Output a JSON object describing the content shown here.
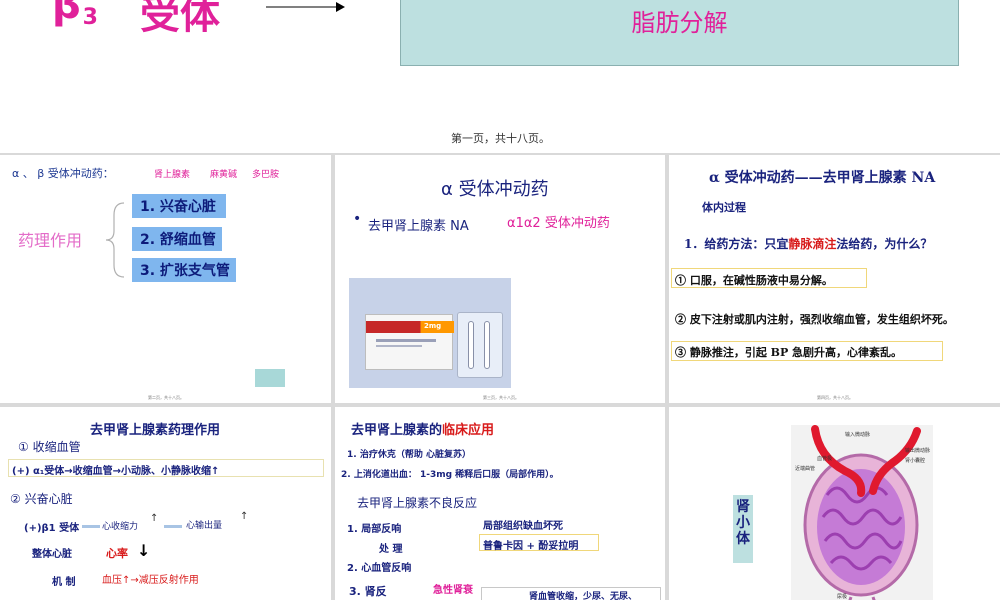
{
  "top": {
    "beta_symbol": "β",
    "beta_sub": "3",
    "receptor_label": "受体",
    "box_text": "脂肪分解",
    "page_caption": "第一页，共十八页。"
  },
  "p1": {
    "heading_prefix": "α 、 β  受体冲动药：",
    "drug1": "肾上腺素",
    "drug2": "麻黄碱",
    "drug3": "多巴胺",
    "pharm_label": "药理作用",
    "items": [
      "1. 兴奋心脏",
      "2. 舒缩血管",
      "3. 扩张支气管"
    ],
    "footer": "第二页，共十八页。"
  },
  "p2": {
    "title": "α 受体冲动药",
    "bullet": "•",
    "drug": "去甲肾上腺素  NA",
    "receptor": "α1α2 受体冲动药",
    "box_label": "2mg",
    "footer": "第三页，共十八页。"
  },
  "p3": {
    "title": "α 受体冲动药——去甲肾上腺素 NA",
    "subtitle": "体内过程",
    "q_prefix": "1．给药方法：只宜",
    "q_red": "静脉滴注",
    "q_suffix": "法给药，为什么？",
    "r1": "①  口服，在碱性肠液中易分解。",
    "r2": "②  皮下注射或肌内注射，强烈收缩血管，发生组织坏死。",
    "r3": "③   静脉推注，引起 BP 急剧升高，心律紊乱。",
    "footer": "第四页，共十八页。"
  },
  "p4": {
    "title": "去甲肾上腺素药理作用",
    "s1": "① 收缩血管",
    "s1_detail": "(+) α₁受体→收缩血管→小动脉、小静脉收缩↑",
    "s2": "② 兴奋心脏",
    "b1": "(+)β1 受体",
    "contract": "心收缩力",
    "output": "心输出量",
    "whole_heart": "整体心脏",
    "rate": "心率",
    "mech": "机  制",
    "bp": "血压↑→减压反射作用"
  },
  "p5": {
    "title_prefix": "去甲肾上腺素的",
    "title_red": "临床应用",
    "u1": "1. 治疗休克（帮助 心脏复苏）",
    "u2": "2. 上消化道出血：  1-3mg 稀释后口服（局部作用）。",
    "adverse": "去甲肾上腺素不良反应",
    "a1": "1. 局部反响",
    "a1_right": "局部组织缺血坏死",
    "treat": "处  理",
    "treat_right": "普鲁卡因 + 酚妥拉明",
    "a2": "2. 心血管反响",
    "a3": "3. 肾反",
    "a3_pink": "急性肾衰",
    "a3_right": "肾血管收缩，少尿、无尿、"
  },
  "p6": {
    "label": "肾小体",
    "callouts": [
      "输入微动脉",
      "输出微动脉",
      "肾小囊腔",
      "近端曲管",
      "血管极",
      "尿极"
    ]
  }
}
